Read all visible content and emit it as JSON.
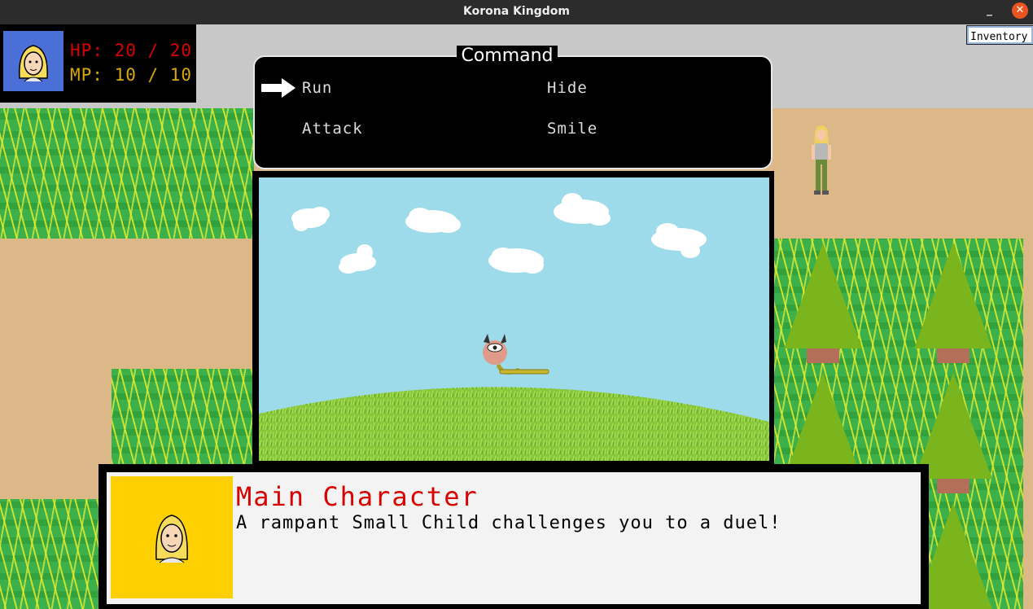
{
  "window": {
    "title": "Korona Kingdom",
    "minimize_glyph": "_",
    "close_glyph": "✕"
  },
  "stats": {
    "hp_text": "HP: 20 / 20",
    "mp_text": "MP: 10 / 10",
    "hp": {
      "current": 20,
      "max": 20
    },
    "mp": {
      "current": 10,
      "max": 10
    }
  },
  "inventory": {
    "label": "Inventory"
  },
  "command_menu": {
    "title": "Command",
    "options": [
      "Run",
      "Hide",
      "Attack",
      "Smile"
    ],
    "selected": "Run"
  },
  "dialog": {
    "speaker": "Main Character",
    "text": "A rampant Small Child challenges you to a duel!"
  },
  "colors": {
    "hp": "#d80000",
    "mp": "#d6a800",
    "speaker": "#d80000",
    "sky": "#9ddaea",
    "grass": "#3cb04a",
    "dirt": "#dcb888",
    "portrait_bg_small": "#4a6fd6",
    "portrait_bg_large": "#ffd000"
  },
  "icons": {
    "cursor": "arrow-right-icon",
    "player_portrait": "blonde-character-portrait-icon",
    "enemy": "small-child-monster-sprite"
  }
}
